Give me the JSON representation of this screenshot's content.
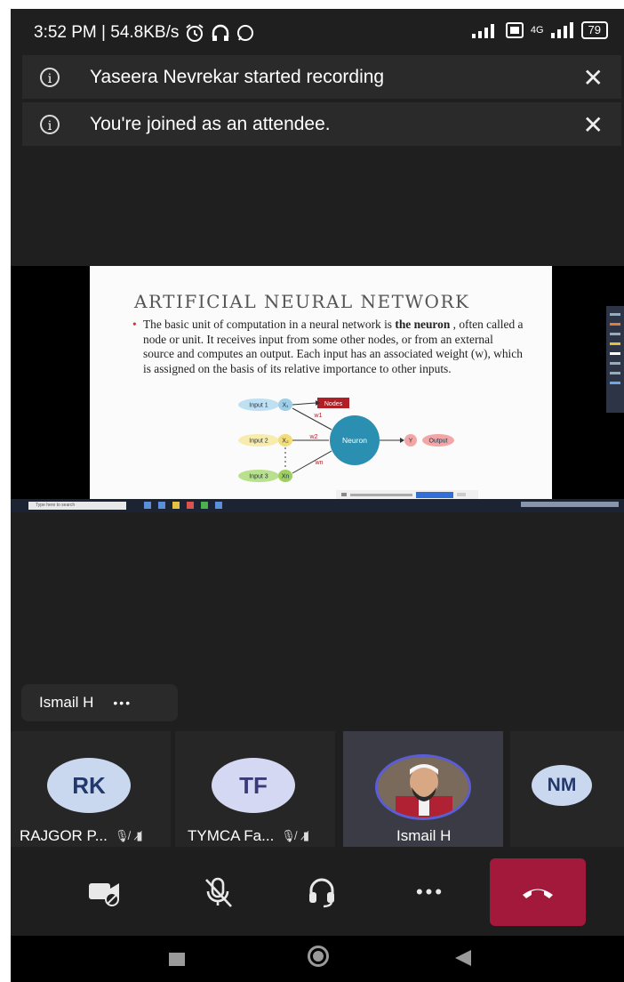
{
  "status_bar": {
    "time_speed": "3:52 PM | 54.8KB/s",
    "network": "4G",
    "battery": "79"
  },
  "banners": [
    {
      "text": "Yaseera Nevrekar started recording"
    },
    {
      "text": "You're joined as an attendee."
    }
  ],
  "slide": {
    "title": "ARTIFICIAL NEURAL NETWORK",
    "body_1": "The basic unit of computation in a neural network is ",
    "body_bold_1": "the",
    "body_bold_2": "neuron",
    "body_2": " , often called a node or unit. It receives input from some other nodes, or from an external source and computes an output. Each input has an associated weight (w), which is assigned on the basis of its relative importance to other inputs.",
    "diagram": {
      "input1": "Input 1",
      "input2": "Input 2",
      "input3": "Input 3",
      "x1": "X₁",
      "x2": "X₂",
      "xn": "Xn",
      "w1": "w1",
      "w2": "w2",
      "wn": "wn",
      "nodes": "Nodes",
      "neuron": "Neuron",
      "y": "Y",
      "output": "Output"
    }
  },
  "taskbar": {
    "search_placeholder": "Type here to search"
  },
  "speaker": {
    "name": "Ismail H",
    "more": "•••"
  },
  "participants": [
    {
      "initials": "RK",
      "name": "RAJGOR P..."
    },
    {
      "initials": "TF",
      "name": "TYMCA Fa..."
    },
    {
      "initials": "",
      "name": "Ismail H"
    },
    {
      "initials": "NM",
      "name": ""
    }
  ],
  "controls": {
    "more": "•••"
  },
  "colors": {
    "hangup": "#a3193b",
    "active_ring": "#5a5dd6",
    "neuron": "#2a8fb0"
  }
}
